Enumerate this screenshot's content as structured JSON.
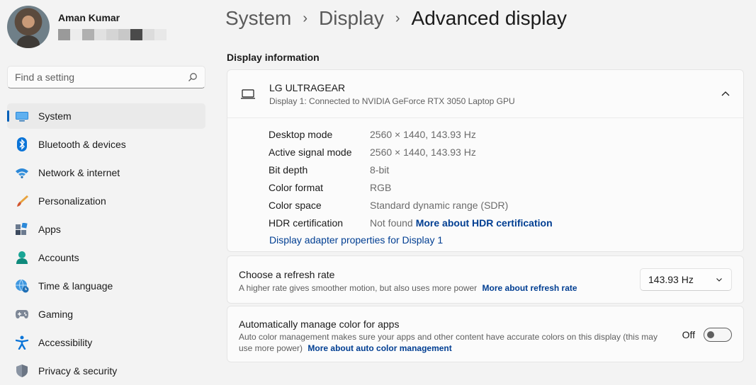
{
  "user": {
    "name": "Aman Kumar",
    "email_blur_colors": [
      "#9a9a9a",
      "#ececec",
      "#b0b0b0",
      "#e1e1e1",
      "#d4d4d4",
      "#c8c8c8",
      "#4a4a4a",
      "#dcdcdc",
      "#e8e8e8"
    ]
  },
  "search": {
    "placeholder": "Find a setting",
    "icon": "search-icon"
  },
  "nav": {
    "items": [
      {
        "label": "System",
        "icon": "system-icon",
        "active": true
      },
      {
        "label": "Bluetooth & devices",
        "icon": "bluetooth-icon"
      },
      {
        "label": "Network & internet",
        "icon": "wifi-icon"
      },
      {
        "label": "Personalization",
        "icon": "brush-icon"
      },
      {
        "label": "Apps",
        "icon": "apps-icon"
      },
      {
        "label": "Accounts",
        "icon": "accounts-icon"
      },
      {
        "label": "Time & language",
        "icon": "globe-clock-icon"
      },
      {
        "label": "Gaming",
        "icon": "gamepad-icon"
      },
      {
        "label": "Accessibility",
        "icon": "accessibility-icon"
      },
      {
        "label": "Privacy & security",
        "icon": "shield-icon"
      }
    ]
  },
  "breadcrumb": {
    "items": [
      "System",
      "Display"
    ],
    "current": "Advanced display",
    "separator": "›"
  },
  "display_info": {
    "section_title": "Display information",
    "name": "LG ULTRAGEAR",
    "subtitle": "Display 1: Connected to NVIDIA GeForce RTX 3050 Laptop GPU",
    "rows": [
      {
        "key": "Desktop mode",
        "value": "2560 × 1440, 143.93 Hz"
      },
      {
        "key": "Active signal mode",
        "value": "2560 × 1440, 143.93 Hz"
      },
      {
        "key": "Bit depth",
        "value": "8-bit"
      },
      {
        "key": "Color format",
        "value": "RGB"
      },
      {
        "key": "Color space",
        "value": "Standard dynamic range (SDR)"
      },
      {
        "key": "HDR certification",
        "value": "Not found",
        "link": "More about HDR certification"
      }
    ],
    "adapter_link": "Display adapter properties for Display 1"
  },
  "refresh": {
    "title": "Choose a refresh rate",
    "desc": "A higher rate gives smoother motion, but also uses more power",
    "link": "More about refresh rate",
    "selected": "143.93 Hz"
  },
  "color_mgmt": {
    "title": "Automatically manage color for apps",
    "desc_line1": "Auto color management makes sure your apps and other content have accurate colors on this display (this may",
    "desc_line2": "use more power)",
    "link": "More about auto color management",
    "toggle_label": "Off",
    "enabled": false
  },
  "colors": {
    "accent": "#005fb8",
    "link": "#003e92",
    "background": "#f3f3f3",
    "card": "#fbfbfb"
  }
}
